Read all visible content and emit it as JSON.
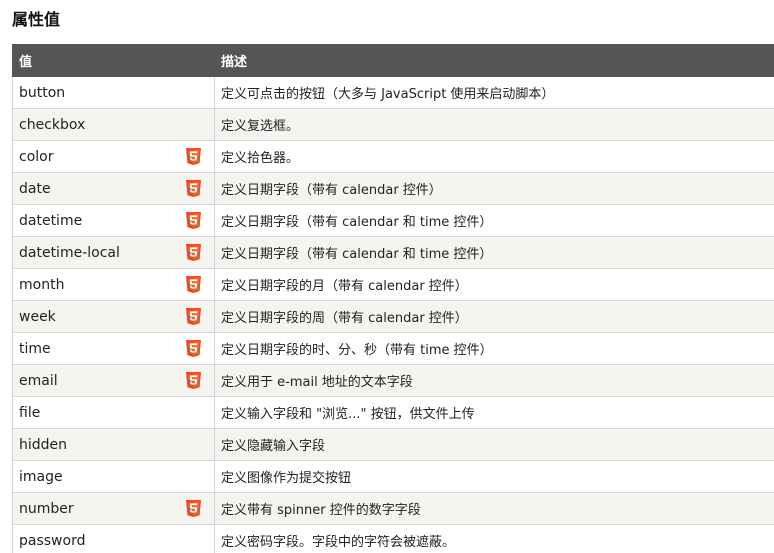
{
  "heading": "属性值",
  "table": {
    "headers": {
      "value": "值",
      "description": "描述"
    },
    "rows": [
      {
        "value": "button",
        "description": "定义可点击的按钮（大多与 JavaScript 使用来启动脚本）",
        "html5": false
      },
      {
        "value": "checkbox",
        "description": "定义复选框。",
        "html5": false
      },
      {
        "value": "color",
        "description": "定义拾色器。",
        "html5": true
      },
      {
        "value": "date",
        "description": "定义日期字段（带有 calendar 控件）",
        "html5": true
      },
      {
        "value": "datetime",
        "description": "定义日期字段（带有 calendar 和 time 控件）",
        "html5": true
      },
      {
        "value": "datetime-local",
        "description": "定义日期字段（带有 calendar 和 time 控件）",
        "html5": true
      },
      {
        "value": "month",
        "description": "定义日期字段的月（带有 calendar 控件）",
        "html5": true
      },
      {
        "value": "week",
        "description": "定义日期字段的周（带有 calendar 控件）",
        "html5": true
      },
      {
        "value": "time",
        "description": "定义日期字段的时、分、秒（带有 time 控件）",
        "html5": true
      },
      {
        "value": "email",
        "description": "定义用于 e-mail 地址的文本字段",
        "html5": true
      },
      {
        "value": "file",
        "description": "定义输入字段和 \"浏览...\" 按钮，供文件上传",
        "html5": false
      },
      {
        "value": "hidden",
        "description": "定义隐藏输入字段",
        "html5": false
      },
      {
        "value": "image",
        "description": "定义图像作为提交按钮",
        "html5": false
      },
      {
        "value": "number",
        "description": "定义带有 spinner 控件的数字字段",
        "html5": true
      },
      {
        "value": "password",
        "description": "定义密码字段。字段中的字符会被遮蔽。",
        "html5": false
      }
    ]
  },
  "icons": {
    "html5_badge": "html5-icon"
  },
  "colors": {
    "header_bg": "#555555",
    "html5_orange": "#e34f26",
    "html5_light": "#ef652a",
    "row_alt": "#f6f4f0",
    "border": "#d4d4d4"
  }
}
